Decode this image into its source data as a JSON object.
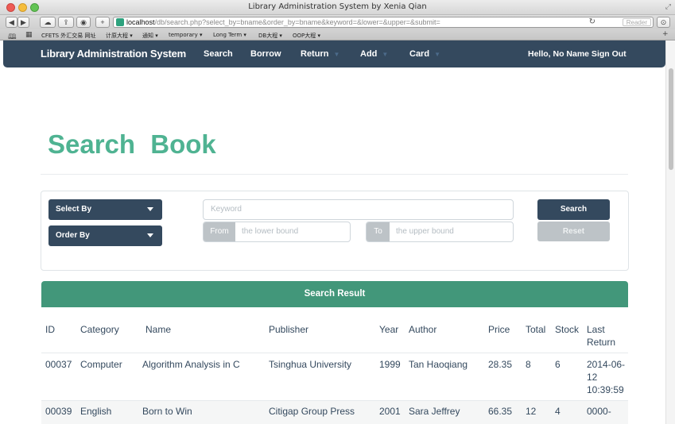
{
  "browser": {
    "window_title": "Library Administration System by Xenia Qian",
    "url_host": "localhost",
    "url_path": "/db/search.php?select_by=bname&order_by=bname&keyword=&lower=&upper=&submit=",
    "reader_label": "Reader",
    "bookmarks": [
      "CFETS 外汇交易 网址",
      "计原大程 ▾",
      "通知 ▾",
      "temporary ▾",
      "Long Term ▾",
      "DB大程 ▾",
      "OOP大程 ▾"
    ]
  },
  "navbar": {
    "brand": "Library Administration System",
    "items": [
      {
        "label": "Search",
        "has_caret": false
      },
      {
        "label": "Borrow",
        "has_caret": false
      },
      {
        "label": "Return",
        "has_caret": true
      },
      {
        "label": "Add",
        "has_caret": true
      },
      {
        "label": "Card",
        "has_caret": true
      }
    ],
    "user_text": "Hello, No Name Sign Out"
  },
  "page": {
    "title": "Search  Book"
  },
  "search": {
    "select_by_label": "Select By",
    "order_by_label": "Order By",
    "keyword_placeholder": "Keyword",
    "from_label": "From",
    "lower_placeholder": "the lower bound",
    "to_label": "To",
    "upper_placeholder": "the upper bound",
    "search_button": "Search",
    "reset_button": "Reset"
  },
  "results": {
    "header": "Search Result",
    "columns": [
      "ID",
      "Category",
      "Name",
      "Publisher",
      "Year",
      "Author",
      "Price",
      "Total",
      "Stock",
      "Last Return"
    ],
    "rows": [
      [
        "00037",
        "Computer",
        "Algorithm Analysis in C",
        "Tsinghua University",
        "1999",
        "Tan Haoqiang",
        "28.35",
        "8",
        "6",
        "2014-06-12 10:39:59"
      ],
      [
        "00039",
        "English",
        "Born to Win",
        "Citigap Group Press",
        "2001",
        "Sara Jeffrey",
        "66.35",
        "12",
        "4",
        "0000-"
      ]
    ]
  },
  "colors": {
    "navbar": "#34495e",
    "title": "#4fb392",
    "result_header": "#42977a",
    "muted": "#bdc3c7"
  }
}
